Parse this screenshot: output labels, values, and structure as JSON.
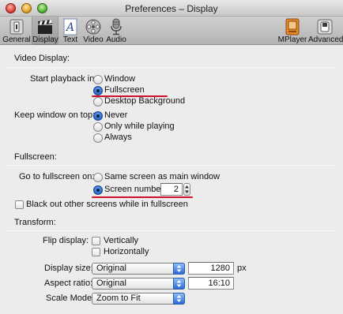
{
  "window": {
    "title": "Preferences – Display"
  },
  "toolbar": {
    "items": [
      {
        "label": "General",
        "icon": "general-icon"
      },
      {
        "label": "Display",
        "icon": "display-clapper-icon",
        "selected": true
      },
      {
        "label": "Text",
        "icon": "text-icon"
      },
      {
        "label": "Video",
        "icon": "video-reel-icon"
      },
      {
        "label": "Audio",
        "icon": "audio-mic-icon"
      },
      {
        "label": "MPlayer",
        "icon": "mplayer-icon"
      },
      {
        "label": "Advanced",
        "icon": "advanced-switch-icon"
      }
    ]
  },
  "video_display": {
    "section_title": "Video Display:",
    "start_playback_label": "Start playback in:",
    "start_playback_options": [
      "Window",
      "Fullscreen",
      "Desktop Background"
    ],
    "start_playback_selected": "Fullscreen",
    "keep_on_top_label": "Keep window on top:",
    "keep_on_top_options": [
      "Never",
      "Only while playing",
      "Always"
    ],
    "keep_on_top_selected": "Never"
  },
  "fullscreen": {
    "section_title": "Fullscreen:",
    "go_fullscreen_label": "Go to fullscreen on:",
    "go_fullscreen_options": [
      "Same screen as main window",
      "Screen number:"
    ],
    "go_fullscreen_selected": "Screen number:",
    "screen_number_value": "2",
    "black_out_label": "Black out other screens while in fullscreen",
    "black_out_checked": false
  },
  "transform": {
    "section_title": "Transform:",
    "flip_label": "Flip display:",
    "flip_vertical_label": "Vertically",
    "flip_horizontal_label": "Horizontally",
    "display_size_label": "Display size:",
    "display_size_value": "Original",
    "display_size_px_value": "1280",
    "display_size_unit": "px",
    "aspect_ratio_label": "Aspect ratio:",
    "aspect_ratio_value": "Original",
    "aspect_ratio_custom_value": "16:10",
    "scale_mode_label": "Scale Mode:",
    "scale_mode_value": "Zoom to Fit"
  },
  "colors": {
    "accent": "#2f72d8",
    "annotation_red": "#d0102a"
  }
}
